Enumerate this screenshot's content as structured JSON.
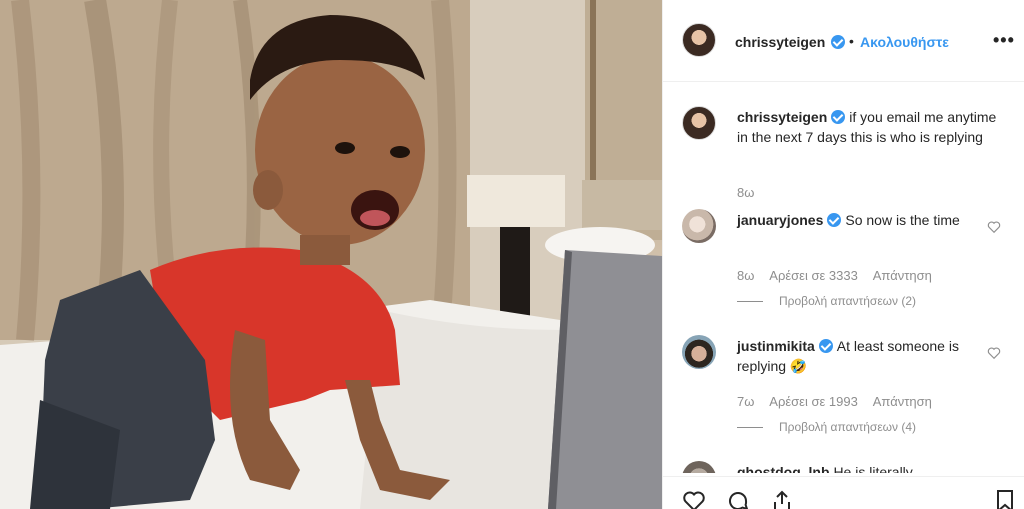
{
  "post": {
    "author": "chrissyteigen",
    "follow_label": "Ακολουθήστε",
    "separator": "•",
    "more_label": "•••"
  },
  "caption": {
    "username": "chrissyteigen",
    "text": "if you email me anytime in the next 7 days this is who is replying",
    "time": "8ω"
  },
  "comments": [
    {
      "username": "januaryjones",
      "text": "So now is the time",
      "time": "8ω",
      "likes": "Αρέσει σε 3333",
      "reply": "Απάντηση",
      "view_replies": "Προβολή απαντήσεων (2)"
    },
    {
      "username": "justinmikita",
      "text": "At least someone is replying 🤣",
      "time": "7ω",
      "likes": "Αρέσει σε 1993",
      "reply": "Απάντηση",
      "view_replies": "Προβολή απαντήσεων (4)"
    },
    {
      "username": "ghostdog_lnb",
      "text": "He is literally"
    }
  ],
  "icons": {
    "verified": "verified-badge-icon",
    "heart": "heart-icon",
    "comment": "comment-icon",
    "share": "share-icon",
    "bookmark": "bookmark-icon"
  },
  "colors": {
    "accent": "#3897f0",
    "muted": "#8e8e8e",
    "text": "#262626"
  }
}
